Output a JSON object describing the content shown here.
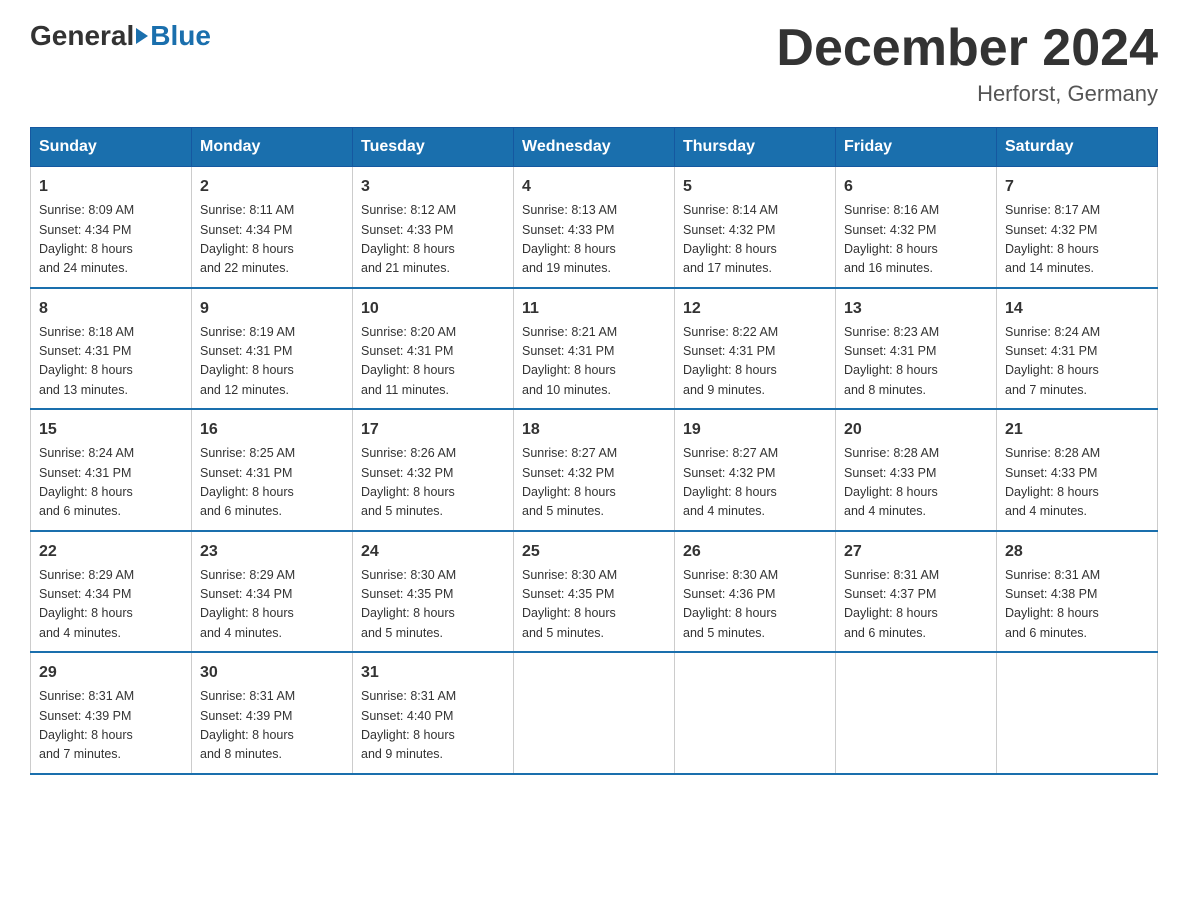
{
  "logo": {
    "general": "General",
    "blue": "Blue"
  },
  "title": "December 2024",
  "subtitle": "Herforst, Germany",
  "weekdays": [
    "Sunday",
    "Monday",
    "Tuesday",
    "Wednesday",
    "Thursday",
    "Friday",
    "Saturday"
  ],
  "weeks": [
    [
      {
        "day": "1",
        "sunrise": "8:09 AM",
        "sunset": "4:34 PM",
        "daylight": "8 hours and 24 minutes."
      },
      {
        "day": "2",
        "sunrise": "8:11 AM",
        "sunset": "4:34 PM",
        "daylight": "8 hours and 22 minutes."
      },
      {
        "day": "3",
        "sunrise": "8:12 AM",
        "sunset": "4:33 PM",
        "daylight": "8 hours and 21 minutes."
      },
      {
        "day": "4",
        "sunrise": "8:13 AM",
        "sunset": "4:33 PM",
        "daylight": "8 hours and 19 minutes."
      },
      {
        "day": "5",
        "sunrise": "8:14 AM",
        "sunset": "4:32 PM",
        "daylight": "8 hours and 17 minutes."
      },
      {
        "day": "6",
        "sunrise": "8:16 AM",
        "sunset": "4:32 PM",
        "daylight": "8 hours and 16 minutes."
      },
      {
        "day": "7",
        "sunrise": "8:17 AM",
        "sunset": "4:32 PM",
        "daylight": "8 hours and 14 minutes."
      }
    ],
    [
      {
        "day": "8",
        "sunrise": "8:18 AM",
        "sunset": "4:31 PM",
        "daylight": "8 hours and 13 minutes."
      },
      {
        "day": "9",
        "sunrise": "8:19 AM",
        "sunset": "4:31 PM",
        "daylight": "8 hours and 12 minutes."
      },
      {
        "day": "10",
        "sunrise": "8:20 AM",
        "sunset": "4:31 PM",
        "daylight": "8 hours and 11 minutes."
      },
      {
        "day": "11",
        "sunrise": "8:21 AM",
        "sunset": "4:31 PM",
        "daylight": "8 hours and 10 minutes."
      },
      {
        "day": "12",
        "sunrise": "8:22 AM",
        "sunset": "4:31 PM",
        "daylight": "8 hours and 9 minutes."
      },
      {
        "day": "13",
        "sunrise": "8:23 AM",
        "sunset": "4:31 PM",
        "daylight": "8 hours and 8 minutes."
      },
      {
        "day": "14",
        "sunrise": "8:24 AM",
        "sunset": "4:31 PM",
        "daylight": "8 hours and 7 minutes."
      }
    ],
    [
      {
        "day": "15",
        "sunrise": "8:24 AM",
        "sunset": "4:31 PM",
        "daylight": "8 hours and 6 minutes."
      },
      {
        "day": "16",
        "sunrise": "8:25 AM",
        "sunset": "4:31 PM",
        "daylight": "8 hours and 6 minutes."
      },
      {
        "day": "17",
        "sunrise": "8:26 AM",
        "sunset": "4:32 PM",
        "daylight": "8 hours and 5 minutes."
      },
      {
        "day": "18",
        "sunrise": "8:27 AM",
        "sunset": "4:32 PM",
        "daylight": "8 hours and 5 minutes."
      },
      {
        "day": "19",
        "sunrise": "8:27 AM",
        "sunset": "4:32 PM",
        "daylight": "8 hours and 4 minutes."
      },
      {
        "day": "20",
        "sunrise": "8:28 AM",
        "sunset": "4:33 PM",
        "daylight": "8 hours and 4 minutes."
      },
      {
        "day": "21",
        "sunrise": "8:28 AM",
        "sunset": "4:33 PM",
        "daylight": "8 hours and 4 minutes."
      }
    ],
    [
      {
        "day": "22",
        "sunrise": "8:29 AM",
        "sunset": "4:34 PM",
        "daylight": "8 hours and 4 minutes."
      },
      {
        "day": "23",
        "sunrise": "8:29 AM",
        "sunset": "4:34 PM",
        "daylight": "8 hours and 4 minutes."
      },
      {
        "day": "24",
        "sunrise": "8:30 AM",
        "sunset": "4:35 PM",
        "daylight": "8 hours and 5 minutes."
      },
      {
        "day": "25",
        "sunrise": "8:30 AM",
        "sunset": "4:35 PM",
        "daylight": "8 hours and 5 minutes."
      },
      {
        "day": "26",
        "sunrise": "8:30 AM",
        "sunset": "4:36 PM",
        "daylight": "8 hours and 5 minutes."
      },
      {
        "day": "27",
        "sunrise": "8:31 AM",
        "sunset": "4:37 PM",
        "daylight": "8 hours and 6 minutes."
      },
      {
        "day": "28",
        "sunrise": "8:31 AM",
        "sunset": "4:38 PM",
        "daylight": "8 hours and 6 minutes."
      }
    ],
    [
      {
        "day": "29",
        "sunrise": "8:31 AM",
        "sunset": "4:39 PM",
        "daylight": "8 hours and 7 minutes."
      },
      {
        "day": "30",
        "sunrise": "8:31 AM",
        "sunset": "4:39 PM",
        "daylight": "8 hours and 8 minutes."
      },
      {
        "day": "31",
        "sunrise": "8:31 AM",
        "sunset": "4:40 PM",
        "daylight": "8 hours and 9 minutes."
      },
      null,
      null,
      null,
      null
    ]
  ],
  "labels": {
    "sunrise": "Sunrise:",
    "sunset": "Sunset:",
    "daylight": "Daylight:"
  }
}
